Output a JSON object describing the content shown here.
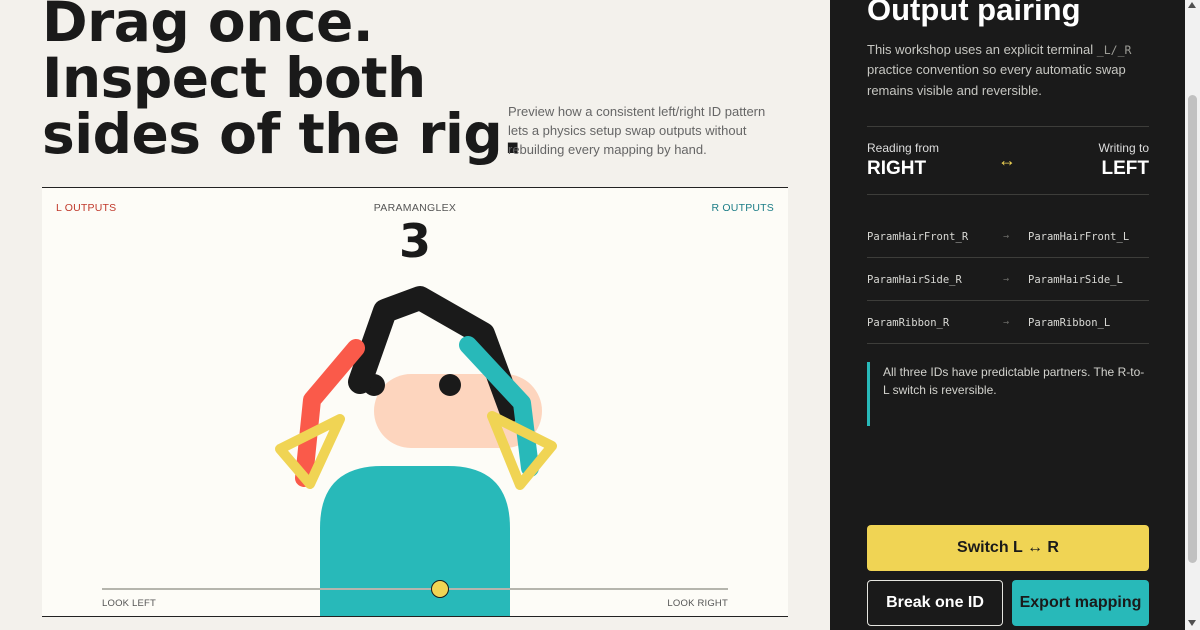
{
  "hero": {
    "title_lines": [
      "Drag once.",
      "Inspect both",
      "sides of the rig."
    ],
    "description": "Preview how a consistent left/right ID pattern lets a physics setup swap outputs without rebuilding every mapping by hand."
  },
  "stage": {
    "left_label": "L OUTPUTS",
    "right_label": "R OUTPUTS",
    "param_name": "PARAMANGLEX",
    "param_value": "3",
    "slider": {
      "min_label": "LOOK LEFT",
      "max_label": "LOOK RIGHT",
      "value_fraction": 0.54
    },
    "colors": {
      "left_output": "#fa5a4a",
      "right_output": "#28b9b9",
      "hair": "#1a1a1a",
      "face": "#fdd5be",
      "body": "#28b9b9",
      "ribbon": "#f0d454"
    }
  },
  "panel": {
    "title": "Output pairing",
    "description_before": "This workshop uses an explicit terminal ",
    "suffix_left": "_L",
    "description_sep": "/",
    "suffix_right": "_R",
    "description_after": " practice convention so every automatic swap remains visible and reversible.",
    "reading_label": "Reading from",
    "reading_value": "RIGHT",
    "swap_arrow": "↔",
    "writing_label": "Writing to",
    "writing_value": "LEFT",
    "mappings": [
      {
        "source": "ParamHairFront_R",
        "arrow": "→",
        "target": "ParamHairFront_L"
      },
      {
        "source": "ParamHairSide_R",
        "arrow": "→",
        "target": "ParamHairSide_L"
      },
      {
        "source": "ParamRibbon_R",
        "arrow": "→",
        "target": "ParamRibbon_L"
      }
    ],
    "note": "All three IDs have predictable partners. The R-to-L switch is reversible.",
    "buttons": {
      "switch": "Switch L ↔ R",
      "break": "Break one ID",
      "export": "Export mapping"
    }
  }
}
